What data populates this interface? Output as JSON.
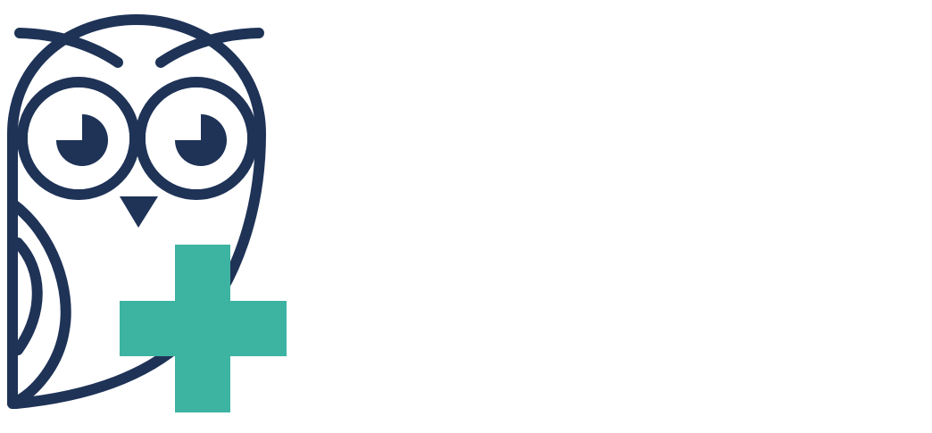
{
  "logo": {
    "name": "owl-medical-cross-logo",
    "icon": "owl-with-plus-icon",
    "colors": {
      "outline": "#1f3357",
      "cross": "#3db3a2",
      "background": "#ffffff"
    }
  }
}
